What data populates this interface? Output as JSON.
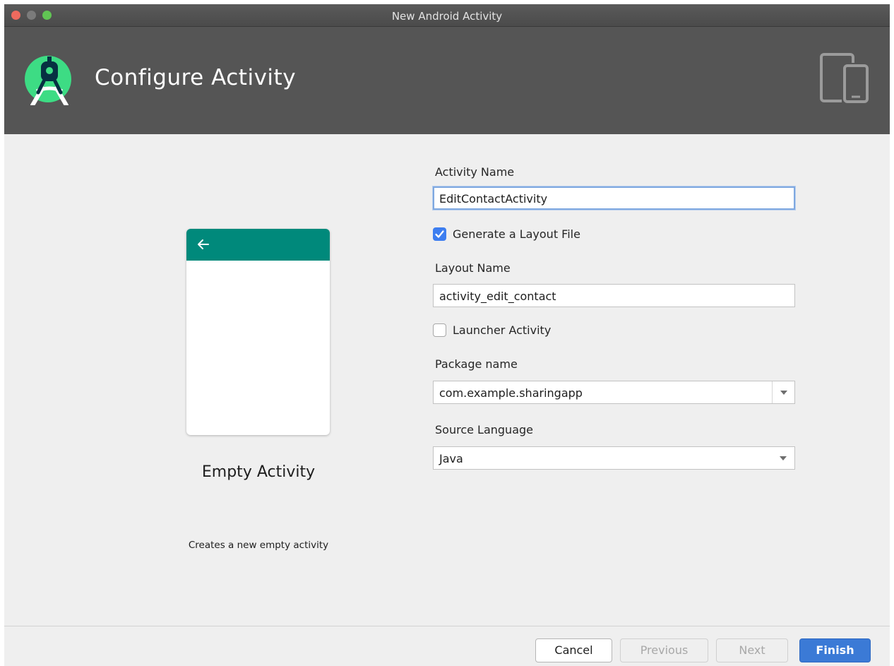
{
  "window": {
    "title": "New Android Activity"
  },
  "header": {
    "title": "Configure Activity",
    "logo_icon": "android-studio-logo-icon",
    "devices_icon": "tablet-phone-icon"
  },
  "template": {
    "name": "Empty Activity",
    "description": "Creates a new empty activity",
    "preview_color": "#00897b"
  },
  "form": {
    "activity_name": {
      "label": "Activity Name",
      "value": "EditContactActivity"
    },
    "generate_layout": {
      "label": "Generate a Layout File",
      "checked": true
    },
    "layout_name": {
      "label": "Layout Name",
      "value": "activity_edit_contact"
    },
    "launcher_activity": {
      "label": "Launcher Activity",
      "checked": false
    },
    "package_name": {
      "label": "Package name",
      "value": "com.example.sharingapp"
    },
    "source_language": {
      "label": "Source Language",
      "value": "Java"
    }
  },
  "buttons": {
    "cancel": "Cancel",
    "previous": "Previous",
    "next": "Next",
    "finish": "Finish"
  }
}
